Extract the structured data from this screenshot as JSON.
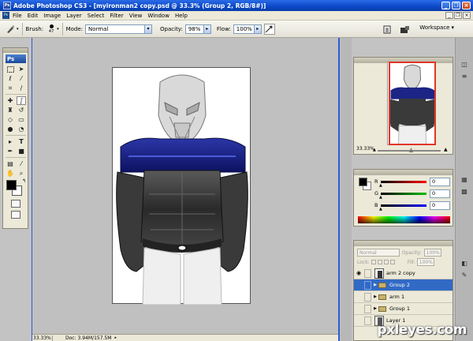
{
  "window": {
    "title": "Adobe Photoshop CS3 - [myironman2 copy.psd @ 33.3% (Group 2, RGB/8#)]",
    "app_icon": "Ps",
    "controls": [
      "_",
      "❐",
      "×"
    ]
  },
  "menu": {
    "items": [
      "File",
      "Edit",
      "Image",
      "Layer",
      "Select",
      "Filter",
      "View",
      "Window",
      "Help"
    ]
  },
  "options": {
    "brush_label": "Brush:",
    "brush_size": "47",
    "mode_label": "Mode:",
    "mode_value": "Normal",
    "opacity_label": "Opacity:",
    "opacity_value": "98%",
    "flow_label": "Flow:",
    "flow_value": "100%",
    "workspace_label": "Workspace"
  },
  "toolbox": {
    "logo": "Ps",
    "foreground_color": "#000000",
    "background_color": "#ffffff"
  },
  "document": {
    "zoom": "33.33%",
    "doc_size": "Doc: 3.94M/157.5M"
  },
  "navigator": {
    "zoom": "33.33%"
  },
  "color_panel": {
    "channels": [
      {
        "label": "R",
        "value": "0",
        "gradient": "linear-gradient(to right, #000, #ff0000)"
      },
      {
        "label": "G",
        "value": "0",
        "gradient": "linear-gradient(to right, #000, #00c000)"
      },
      {
        "label": "B",
        "value": "0",
        "gradient": "linear-gradient(to right, #000, #0000ff)"
      }
    ]
  },
  "layers": {
    "blend_mode": "Normal",
    "opacity_label": "Opacity:",
    "opacity_value": "100%",
    "lock_label": "Lock:",
    "fill_label": "Fill:",
    "fill_value": "100%",
    "rows": [
      {
        "name": "arm 2 copy",
        "type": "layer",
        "visible": true,
        "selected": false
      },
      {
        "name": "Group 2",
        "type": "group",
        "visible": false,
        "selected": true
      },
      {
        "name": "arm 1",
        "type": "group",
        "visible": false,
        "selected": false
      },
      {
        "name": "Group 1",
        "type": "group",
        "visible": false,
        "selected": false
      },
      {
        "name": "Layer 1",
        "type": "layer",
        "visible": false,
        "selected": false
      }
    ]
  },
  "watermark": "pxleyes.com",
  "colors": {
    "accent_blue": "#316ac5",
    "titlebar_blue": "#0a48c8",
    "navigator_proxy": "#e0362a"
  }
}
